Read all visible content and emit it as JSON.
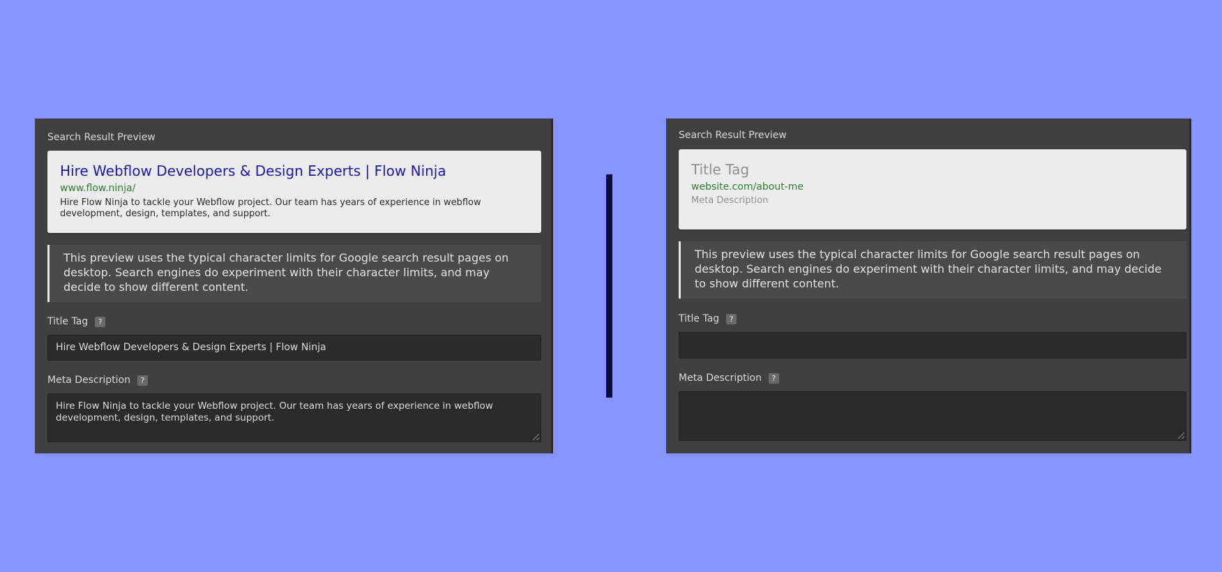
{
  "left": {
    "section_label": "Search Result Preview",
    "serp": {
      "title": "Hire Webflow Developers & Design Experts | Flow Ninja",
      "url": "www.flow.ninja/",
      "description": "Hire Flow Ninja to tackle your Webflow project. Our team has years of experience in webflow development, design, templates, and support."
    },
    "note": "This preview uses the typical character limits for Google search result pages on desktop. Search engines do experiment with their character limits, and may decide to show different content.",
    "title_tag": {
      "label": "Title Tag",
      "help": "?",
      "value": "Hire Webflow Developers & Design Experts | Flow Ninja"
    },
    "meta_description": {
      "label": "Meta Description",
      "help": "?",
      "value": "Hire Flow Ninja to tackle your Webflow project. Our team has years of experience in webflow development, design, templates, and support."
    }
  },
  "right": {
    "section_label": "Search Result Preview",
    "serp": {
      "title": "Title Tag",
      "url": "website.com/about-me",
      "description": "Meta Description"
    },
    "note": "This preview uses the typical character limits for Google search result pages on desktop. Search engines do experiment with their character limits, and may decide to show different content.",
    "title_tag": {
      "label": "Title Tag",
      "help": "?",
      "value": ""
    },
    "meta_description": {
      "label": "Meta Description",
      "help": "?",
      "value": ""
    }
  },
  "colors": {
    "background": "#8794fe",
    "panel": "#404040",
    "serp_title_link": "#1a1aa6",
    "serp_url": "#2e7d32",
    "divider": "#0e0e3a"
  }
}
